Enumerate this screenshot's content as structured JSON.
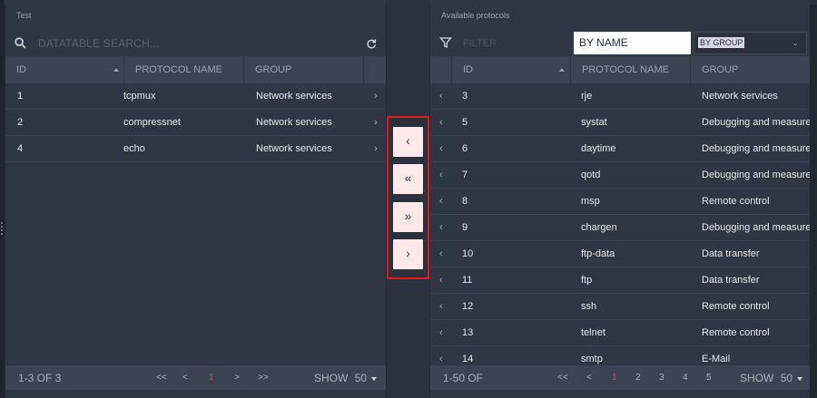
{
  "left": {
    "title": "Test",
    "search_placeholder": "DATATABLE SEARCH...",
    "columns": [
      "ID",
      "PROTOCOL NAME",
      "GROUP"
    ],
    "rows": [
      {
        "id": "1",
        "name": "tcpmux",
        "group": "Network services"
      },
      {
        "id": "2",
        "name": "compressnet",
        "group": "Network services"
      },
      {
        "id": "4",
        "name": "echo",
        "group": "Network services"
      }
    ],
    "footer": {
      "count": "1-3 OF 3",
      "first": "<<",
      "prev": "<",
      "page": "1",
      "next": ">",
      "last": ">>",
      "show_label": "SHOW",
      "show_value": "50"
    }
  },
  "right": {
    "title": "Available protocols",
    "filter_placeholder": "FILTER",
    "by_name": "BY NAME",
    "by_group": "BY GROUP",
    "columns": [
      "ID",
      "PROTOCOL NAME",
      "GROUP"
    ],
    "rows": [
      {
        "id": "3",
        "name": "rje",
        "group": "Network services"
      },
      {
        "id": "5",
        "name": "systat",
        "group": "Debugging and measurement"
      },
      {
        "id": "6",
        "name": "daytime",
        "group": "Debugging and measurement"
      },
      {
        "id": "7",
        "name": "qotd",
        "group": "Debugging and measurement"
      },
      {
        "id": "8",
        "name": "msp",
        "group": "Remote control"
      },
      {
        "id": "9",
        "name": "chargen",
        "group": "Debugging and measurement"
      },
      {
        "id": "10",
        "name": "ftp-data",
        "group": "Data transfer"
      },
      {
        "id": "11",
        "name": "ftp",
        "group": "Data transfer"
      },
      {
        "id": "12",
        "name": "ssh",
        "group": "Remote control"
      },
      {
        "id": "13",
        "name": "telnet",
        "group": "Remote control"
      },
      {
        "id": "14",
        "name": "smtp",
        "group": "E-Mail"
      }
    ],
    "footer": {
      "count": "1-50 OF",
      "first": "<<",
      "prev": "<",
      "pages": [
        "1",
        "2",
        "3",
        "4",
        "5"
      ],
      "show_label": "SHOW",
      "show_value": "50"
    }
  },
  "move_buttons": {
    "move_one_left": "‹",
    "move_all_left": "«",
    "move_all_right": "»",
    "move_one_right": "›"
  },
  "row_chevron_right": "›",
  "row_chevron_left": "‹",
  "colors": {
    "panel_bg": "#2f3644",
    "header_bg": "#3c4453",
    "accent_red": "#d51c24",
    "active_page": "#e0474c",
    "button_bg": "#fde9ea"
  }
}
